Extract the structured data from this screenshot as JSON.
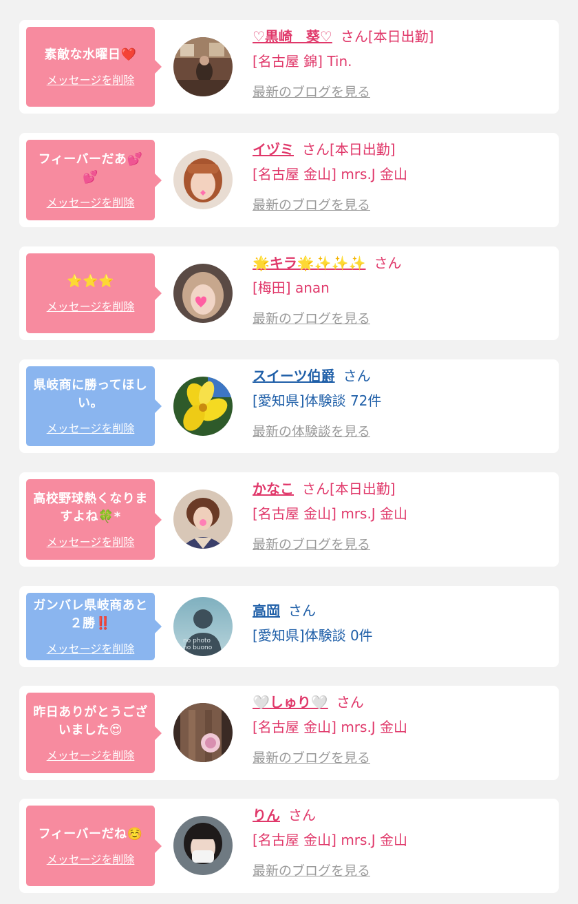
{
  "common": {
    "delete_label": "メッセージを削除",
    "san": "さん"
  },
  "items": [
    {
      "bubble": "素敵な水曜日❤️",
      "name": "♡黒崎　葵♡",
      "status": "[本日出勤]",
      "shop": "[名古屋 錦] Tin.",
      "link": "最新のブログを見る",
      "avatar": "photo-room"
    },
    {
      "bubble": "フィーバーだあ💕💕",
      "name": "イヅミ",
      "status": "[本日出勤]",
      "shop": "[名古屋 金山] mrs.J 金山",
      "link": "最新のブログを見る",
      "avatar": "photo-woman-red-hair"
    },
    {
      "bubble": "⭐⭐⭐",
      "name": "🌟キラ🌟✨✨✨",
      "status": "",
      "shop": "[梅田] anan",
      "link": "最新のブログを見る",
      "avatar": "photo-woman-heart"
    },
    {
      "bubble": "県岐商に勝ってほしい。",
      "name": "スイーツ伯爵",
      "status": "",
      "shop": "[愛知県]体験談 72件",
      "link": "最新の体験談を見る",
      "avatar": "photo-yellow-flower"
    },
    {
      "bubble": "高校野球熱くなりますよね🍀*",
      "name": "かなこ",
      "status": "[本日出勤]",
      "shop": "[名古屋 金山] mrs.J 金山",
      "link": "最新のブログを見る",
      "avatar": "photo-woman-kimono"
    },
    {
      "bubble": "ガンバレ県岐商あと２勝‼️",
      "name": "高岡",
      "status": "",
      "shop": "[愛知県]体験談 0件",
      "link": "",
      "avatar": "no-photo-silhouette"
    },
    {
      "bubble": "昨日ありがとうございました😍",
      "name": "🤍しゅり🤍",
      "status": "",
      "shop": "[名古屋 金山] mrs.J 金山",
      "link": "最新のブログを見る",
      "avatar": "photo-woman-long-hair"
    },
    {
      "bubble": "フィーバーだね☺️",
      "name": "りん",
      "status": "",
      "shop": "[名古屋 金山] mrs.J 金山",
      "link": "最新のブログを見る",
      "avatar": "photo-woman-mask"
    }
  ],
  "avatar_no_photo_text": "no photo\nno buono"
}
